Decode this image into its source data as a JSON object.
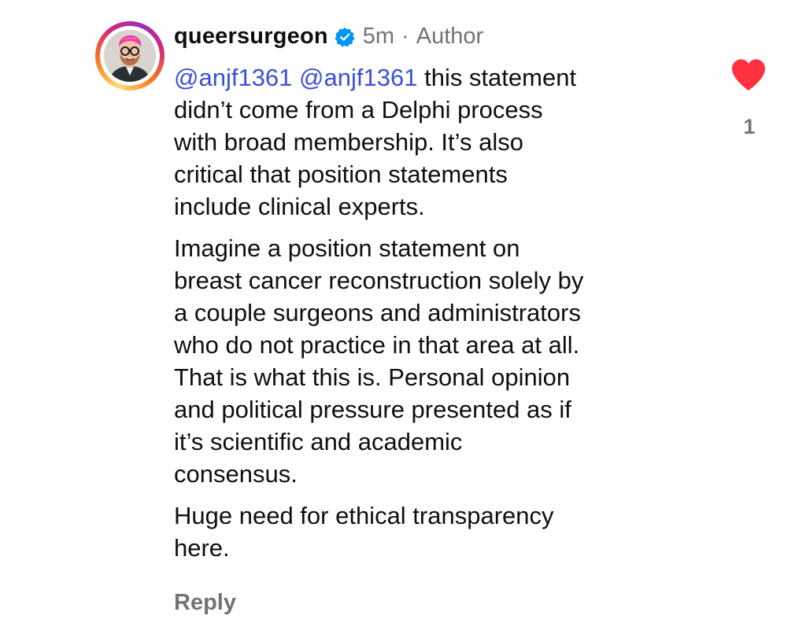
{
  "comment": {
    "username": "queersurgeon",
    "time": "5m",
    "separator": "·",
    "role": "Author",
    "mention_1": "@anjf1361",
    "mention_2": "@anjf1361",
    "p1_rest": "this statement\ndidn’t come from a Delphi process\nwith broad membership. It’s also\ncritical that position statements\ninclude clinical experts.",
    "p2": "Imagine a position statement on\nbreast cancer reconstruction solely by\na couple surgeons and administrators\nwho do not practice in that area at all.\nThat is what this is. Personal opinion\nand political pressure presented as if\nit’s scientific and academic\nconsensus.",
    "p3": "Huge need for ethical transparency\nhere.",
    "reply_label": "Reply",
    "like_count": "1"
  },
  "icons": {
    "verified": "verified-badge-icon",
    "like": "heart-icon",
    "avatar": "profile-photo"
  },
  "colors": {
    "mention": "#3a51d6",
    "verified": "#0095f6",
    "heart": "#ff3040",
    "muted": "#737373",
    "text": "#0f0f0f"
  }
}
